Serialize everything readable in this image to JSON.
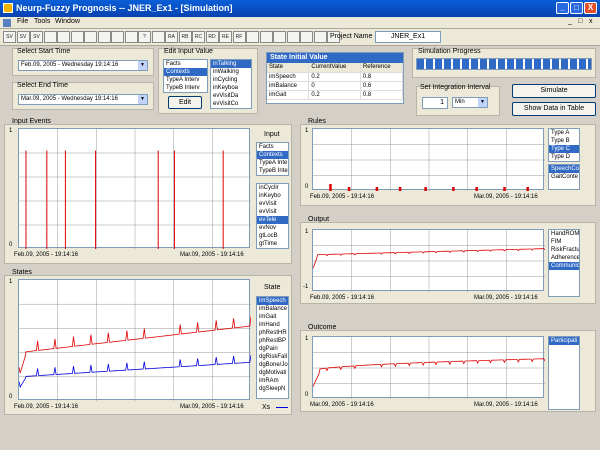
{
  "window": {
    "title": "Neurp-Fuzzy Prognosis -- JNER_Ex1 - [Simulation]",
    "min": "_",
    "max": "□",
    "close": "X",
    "inner_min": "_",
    "inner_max": "□",
    "inner_close": "x"
  },
  "menu": [
    "File",
    "Tools",
    "Window"
  ],
  "toolbar": [
    "SV",
    "SV",
    "SV",
    "",
    "",
    "",
    "",
    "",
    "",
    "",
    "?",
    "",
    "RA",
    "RB",
    "RC",
    "RD",
    "RE",
    "RF",
    "",
    "",
    "",
    "",
    "",
    "",
    ""
  ],
  "project": {
    "label": "Project Name",
    "value": "JNER_Ex1"
  },
  "start_time": {
    "label": "Select Start Time",
    "value": "Feb.09, 2005 - Wednesday 19:14:16"
  },
  "end_time": {
    "label": "Select End Time",
    "value": "Mar.09, 2005 - Wednesday 19:14:16"
  },
  "edit_input": {
    "label": "Edit Input Value",
    "left_items": [
      "Facts",
      "Contexts",
      "TypeA Interv",
      "TypeB Interv"
    ],
    "left_selected": 1,
    "right_items": [
      "inTalking",
      "inWalking",
      "inCycling",
      "inKeyboa",
      "evVisitDa",
      "evVisitCo"
    ],
    "right_selected": 0,
    "edit_label": "Edit"
  },
  "state_initial": {
    "title": "State Initial Value",
    "headers": [
      "State",
      "CurrentValue",
      "Reference"
    ],
    "rows": [
      [
        "imSpeech",
        "0.2",
        "0.8"
      ],
      [
        "imBalance",
        "0",
        "0.6"
      ],
      [
        "imGait",
        "0.2",
        "0.8"
      ]
    ]
  },
  "sim_progress": {
    "label": "Simulation Progress",
    "progress": 1.0
  },
  "integration": {
    "label": "Set Integration Interval",
    "value": "1",
    "unit": "Min"
  },
  "simulate_label": "Simulate",
  "show_table_label": "Show Data in Table",
  "input_events": {
    "label": "Input Events",
    "list_label": "Input",
    "list1": [
      "Facts",
      "Contexts",
      "TypeA Inte",
      "TypeB Inte"
    ],
    "list1_selected": 1,
    "list2": [
      "inCyclir",
      "inKeybo",
      "evVisit",
      "evVisit",
      "evTele",
      "evNov",
      "gtLocB",
      "gtTime"
    ],
    "list2_selected": 4,
    "ymax": "1",
    "ymin": "0",
    "xstart": "Feb.09, 2005 - 19:14:16",
    "xend": "Mar.09, 2005 - 19:14:16"
  },
  "states": {
    "label": "States",
    "list_label": "State",
    "list": [
      "imSpeech",
      "imBalance",
      "imGait",
      "imHand",
      "phRestHR",
      "phRestBP",
      "dgPain",
      "dgRiskFall",
      "dgBone/Jo",
      "dgMotivati",
      "imRAm",
      "dgSleepN"
    ],
    "list_selected": 0,
    "ymax": "1",
    "ymin": "0",
    "xstart": "Feb.09, 2005 - 19:14:16",
    "xend": "Mar.09, 2005 - 19:14:16",
    "xs_label": "Xs"
  },
  "rules": {
    "label": "Rules",
    "list1": [
      "Type A",
      "Type B",
      "Type C",
      "Type D"
    ],
    "list1_selected": 2,
    "list2": [
      "SpeechCo",
      "GaitConte"
    ],
    "list2_selected": 0,
    "ymax": "1",
    "ymin": "0",
    "xstart": "Feb.09, 2005 - 19:14:16",
    "xend": "Mar.09, 2005 - 19:14:16"
  },
  "output": {
    "label": "Output",
    "list": [
      "HandROM",
      "FIM",
      "RiskFractu",
      "Adherence",
      "Communic"
    ],
    "list_selected": 4,
    "ymax": "1",
    "ymin": "-1",
    "xstart": "Feb.09, 2005 - 19:14:16",
    "xend": "Mar.09, 2005 - 19:14:16"
  },
  "outcome": {
    "label": "Outcome",
    "list": [
      "Participati"
    ],
    "list_selected": 0,
    "ymax": "1",
    "ymin": "0",
    "xstart": "Mar.09, 2005 - 19:14:16",
    "xend": "Mar.09, 2005 - 19:14:16"
  },
  "colors": {
    "red": "#e00000",
    "blue": "#0000e0",
    "selection": "#316ac5"
  }
}
